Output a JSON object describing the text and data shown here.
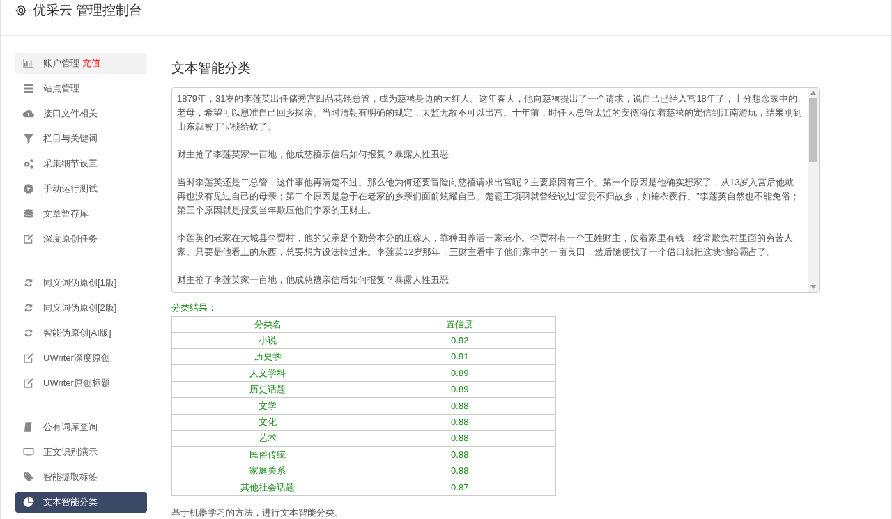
{
  "header": {
    "title": "优采云 管理控制台"
  },
  "sidebar": {
    "groups": [
      {
        "items": [
          {
            "label": "账户管理",
            "badge": "充值",
            "selected": false,
            "hover": true
          },
          {
            "label": "站点管理",
            "selected": false
          },
          {
            "label": "接口文件相关",
            "selected": false
          },
          {
            "label": "栏目与关键词",
            "selected": false
          },
          {
            "label": "采集细节设置",
            "selected": false
          },
          {
            "label": "手动运行测试",
            "selected": false
          },
          {
            "label": "文章暂存库",
            "selected": false
          },
          {
            "label": "深度原创任务",
            "selected": false
          }
        ]
      },
      {
        "items": [
          {
            "label": "同义词伪原创[1版]",
            "selected": false
          },
          {
            "label": "同义词伪原创[2版]",
            "selected": false
          },
          {
            "label": "智能伪原创[AI版]",
            "selected": false
          },
          {
            "label": "UWriter深度原创",
            "selected": false
          },
          {
            "label": "UWriter原创标题",
            "selected": false
          }
        ]
      },
      {
        "items": [
          {
            "label": "公有词库查询",
            "selected": false
          },
          {
            "label": "正文识别演示",
            "selected": false
          },
          {
            "label": "智能提取标签",
            "selected": false
          },
          {
            "label": "文本智能分类",
            "selected": true
          }
        ]
      }
    ]
  },
  "main": {
    "title": "文本智能分类",
    "text_area": {
      "paragraphs": [
        "1879年，31岁的李莲英出任储秀宫四品花翎总管，成为慈禧身边的大红人。这年春天，他向慈禧提出了一个请求，说自己已经入宫18年了，十分想念家中的老母，希望可以恩准自己回乡探亲。当时清朝有明确的规定，太监无故不可以出宫。十年前，时任大总管太监的安德海仗着慈禧的宠信到江南游玩，结果刚到山东就被丁宝桢给砍了。",
        "财主抢了李莲英家一亩地，他成慈禧亲信后如何报复？暴露人性丑恶",
        "当时李莲英还是二总管，这件事他再清楚不过。那么他为何还要冒险向慈禧请求出宫呢？主要原因有三个。第一个原因是他确实想家了，从13岁入宫后他就再也没有见过自己的母亲；第二个原因是急于在老家的乡亲们面前炫耀自己。楚霸王项羽就曾经说过“富贵不归故乡，如锦衣夜行。”李莲英自然也不能免俗；第三个原因就是报复当年欺压他们李家的王财主。",
        "李莲英的老家在大城县李贾村，他的父亲是个勤劳本分的庄稼人，靠种田养活一家老小。李贾村有一个王姓财主，仗着家里有钱，经常欺负村里面的穷苦人家。只要是他看上的东西，总要想方设法搞过来。李莲英12岁那年，王财主看中了他们家中的一亩良田，然后随便找了一个借口就把这块地给霸占了。",
        "财主抢了李莲英家一亩地，他成慈禧亲信后如何报复？暴露人性丑恶"
      ]
    },
    "result_label": "分类结果：",
    "table": {
      "columns": [
        "分类名",
        "置信度"
      ],
      "rows": [
        [
          "小说",
          "0.92"
        ],
        [
          "历史学",
          "0.91"
        ],
        [
          "人文学科",
          "0.89"
        ],
        [
          "历史话题",
          "0.89"
        ],
        [
          "文学",
          "0.88"
        ],
        [
          "文化",
          "0.88"
        ],
        [
          "艺术",
          "0.88"
        ],
        [
          "民俗传统",
          "0.88"
        ],
        [
          "家庭关系",
          "0.88"
        ],
        [
          "其他社会话题",
          "0.87"
        ]
      ]
    },
    "description": "基于机器学习的方法，进行文本智能分类。"
  }
}
